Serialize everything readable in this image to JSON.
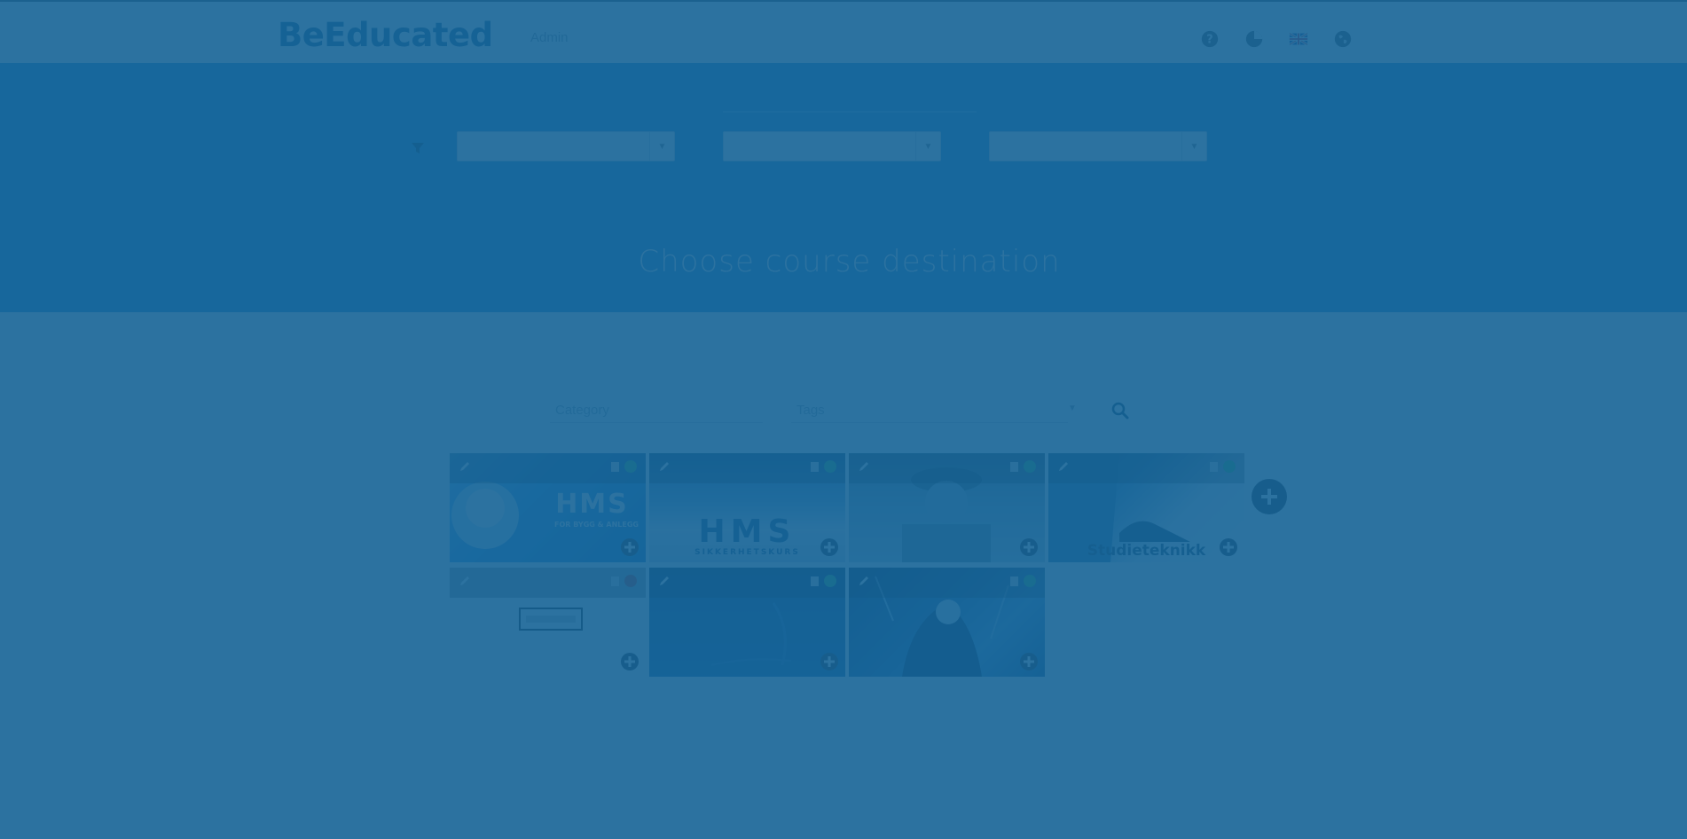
{
  "header": {
    "logo": "BeEducated",
    "section": "Admin",
    "icons": [
      "help-icon",
      "chart-icon",
      "language-flag-icon",
      "globe-icon"
    ]
  },
  "hero": {
    "title": "Choose course destination",
    "filters": [
      {
        "value": "",
        "placeholder": ""
      },
      {
        "value": "",
        "placeholder": ""
      },
      {
        "value": "",
        "placeholder": ""
      }
    ]
  },
  "search": {
    "category_placeholder": "Category",
    "tags_placeholder": "Tags"
  },
  "courses": [
    {
      "caption": "HMS",
      "subcaption": "FOR BYGG & ANLEGG",
      "status": "active"
    },
    {
      "caption": "HMS",
      "subcaption": "SIKKERHETSKURS",
      "status": "active"
    },
    {
      "caption": "",
      "subcaption": "",
      "status": "active"
    },
    {
      "caption": "Studieteknikk",
      "subcaption": "",
      "status": "active"
    },
    {
      "caption": "",
      "subcaption": "",
      "status": "inactive"
    },
    {
      "caption": "",
      "subcaption": "",
      "status": "active"
    },
    {
      "caption": "",
      "subcaption": "",
      "status": "active"
    }
  ],
  "colors": {
    "brand": "#1c5d8d",
    "hero": "#2a8ad3",
    "overlay": "#156396",
    "status_active": "#3fbf5f",
    "status_inactive": "#c0392b"
  }
}
